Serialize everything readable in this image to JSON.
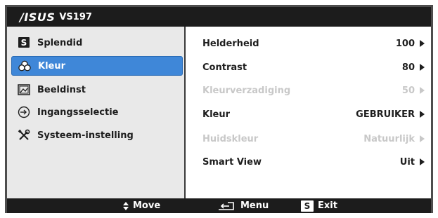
{
  "header": {
    "brand": "/ISUS",
    "model": "VS197"
  },
  "sidebar": {
    "selected_index": 1,
    "items": [
      {
        "label": "Splendid",
        "icon": "splendid-s-icon"
      },
      {
        "label": "Kleur",
        "icon": "color-circles-icon"
      },
      {
        "label": "Beeldinst",
        "icon": "image-settings-icon"
      },
      {
        "label": "Ingangsselectie",
        "icon": "input-select-icon"
      },
      {
        "label": "Systeem-instelling",
        "icon": "tools-icon"
      }
    ]
  },
  "settings": {
    "rows": [
      {
        "label": "Helderheid",
        "value": "100",
        "enabled": true
      },
      {
        "label": "Contrast",
        "value": "80",
        "enabled": true
      },
      {
        "label": "Kleurverzadiging",
        "value": "50",
        "enabled": false
      },
      {
        "label": "Kleur",
        "value": "GEBRUIKER",
        "enabled": true
      },
      {
        "label": "Huidskleur",
        "value": "Natuurlijk",
        "enabled": false
      },
      {
        "label": "Smart View",
        "value": "Uit",
        "enabled": true
      }
    ]
  },
  "footer": {
    "move_label": "Move",
    "menu_label": "Menu",
    "exit_key": "S",
    "exit_label": "Exit"
  },
  "colors": {
    "highlight": "#3f87d8",
    "header_bg": "#1c1c1c",
    "sidebar_bg": "#e9e9e9",
    "disabled_text": "#c8c8c8"
  }
}
